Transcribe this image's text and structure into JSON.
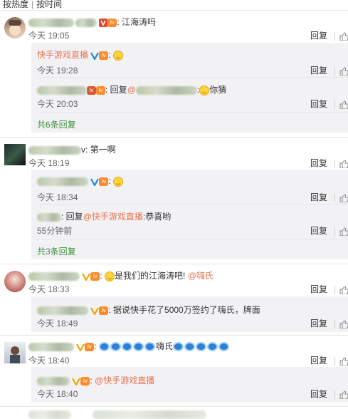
{
  "sort": {
    "hot": "按热度",
    "time": "按时间"
  },
  "labels": {
    "reply": "回复"
  },
  "comments": [
    {
      "text": "江海涛吗",
      "time": "今天 19:05",
      "replies": [
        {
          "name": "快手游戏直播",
          "time": "今天 19:28"
        },
        {
          "text_prefix": "回复",
          "text_suffix": "你猜",
          "time": "今天 20:03"
        }
      ],
      "more": "共6条回复"
    },
    {
      "text": "第一啊",
      "time": "今天 18:19",
      "replies": [
        {
          "time": "今天 18:34"
        },
        {
          "text_prefix": "回复",
          "mention": "@快手游戏直播",
          "text_suffix": ":恭喜哟",
          "time": "55分钟前"
        }
      ],
      "more": "共3条回复"
    },
    {
      "text": "是我们的江海涛吧!",
      "mention": "@嗨氏",
      "time": "今天 18:33",
      "replies": [
        {
          "text": "据说快手花了5000万签约了嗨氏，牌面",
          "time": "今天 18:49"
        }
      ]
    },
    {
      "text": "嗨氏",
      "time": "今天 18:40",
      "replies": [
        {
          "mention": "@快手游戏直播",
          "time": "今天 18:40"
        }
      ]
    }
  ],
  "colors": {
    "name": "#eb7350",
    "more": "#3e8e3e",
    "reply_bg": "#f2f2f5"
  }
}
